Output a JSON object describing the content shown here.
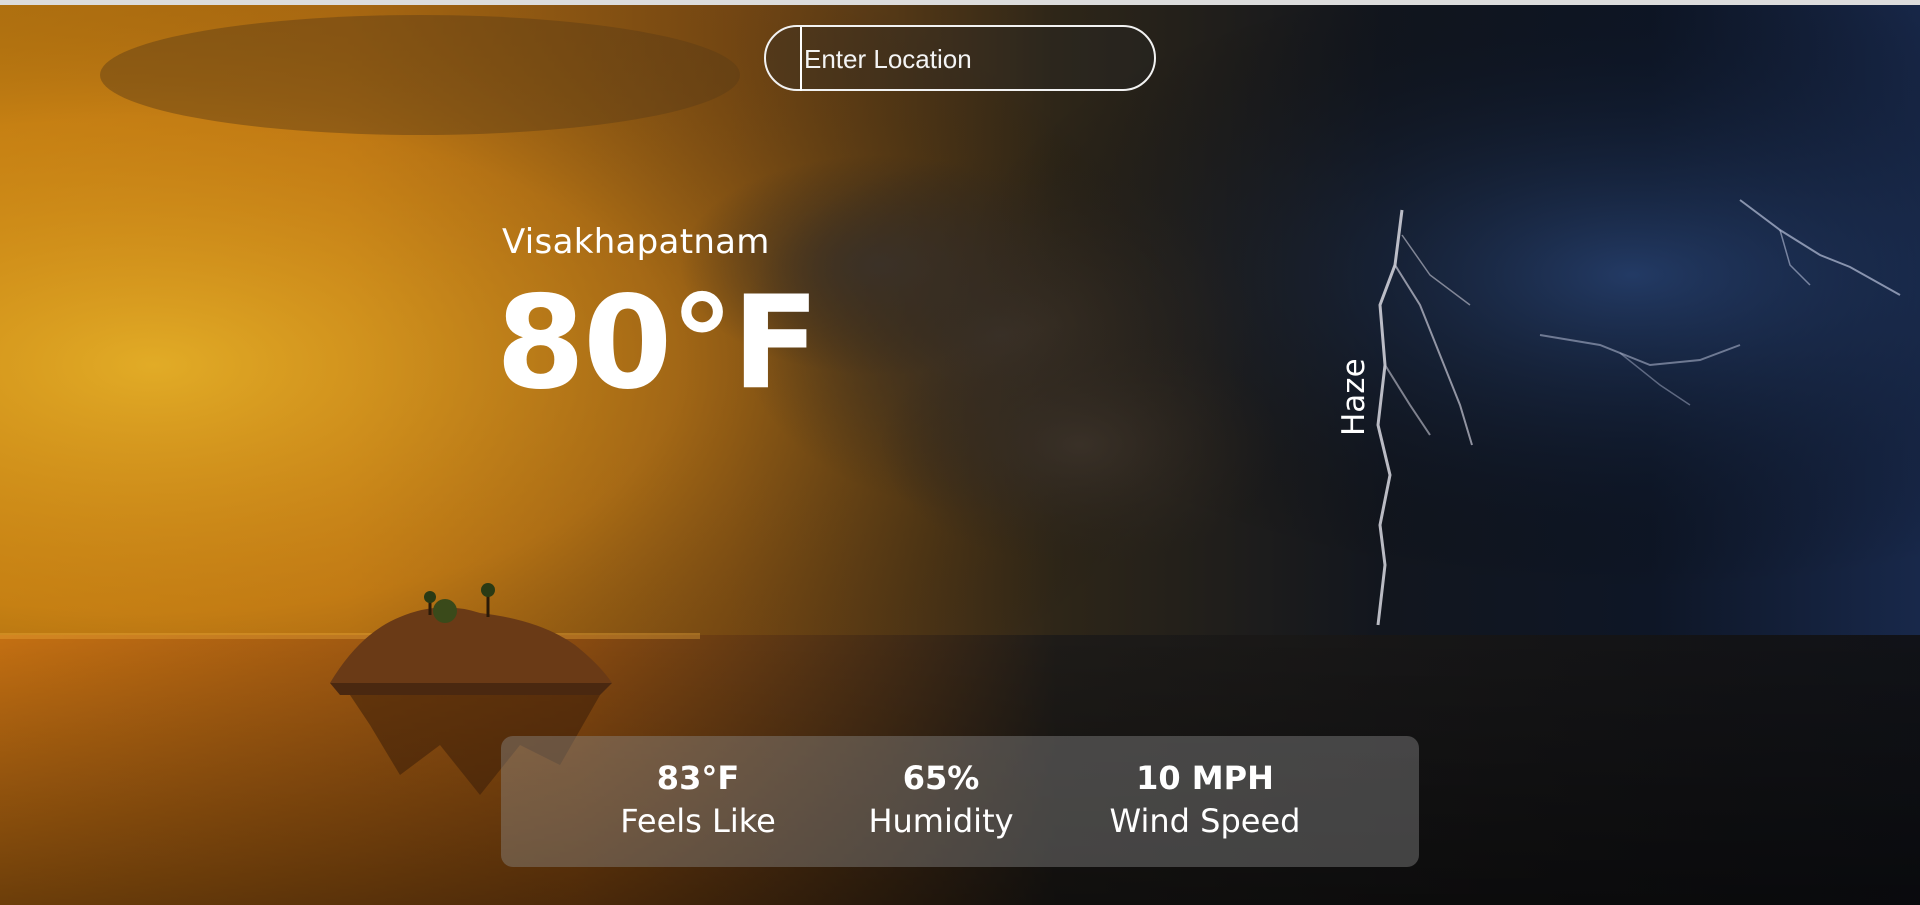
{
  "search": {
    "placeholder": "Enter Location"
  },
  "weather": {
    "location": "Visakhapatnam",
    "temperature": "80°F",
    "condition": "Haze"
  },
  "stats": {
    "feels_like": {
      "value": "83°F",
      "label": "Feels Like"
    },
    "humidity": {
      "value": "65%",
      "label": "Humidity"
    },
    "wind_speed": {
      "value": "10 MPH",
      "label": "Wind Speed"
    }
  },
  "colors": {
    "sunset": "#c07a10",
    "storm_dark": "#12161e",
    "storm_blue": "#18284a",
    "text": "#ffffff",
    "panel": "rgba(140,140,140,0.42)"
  }
}
